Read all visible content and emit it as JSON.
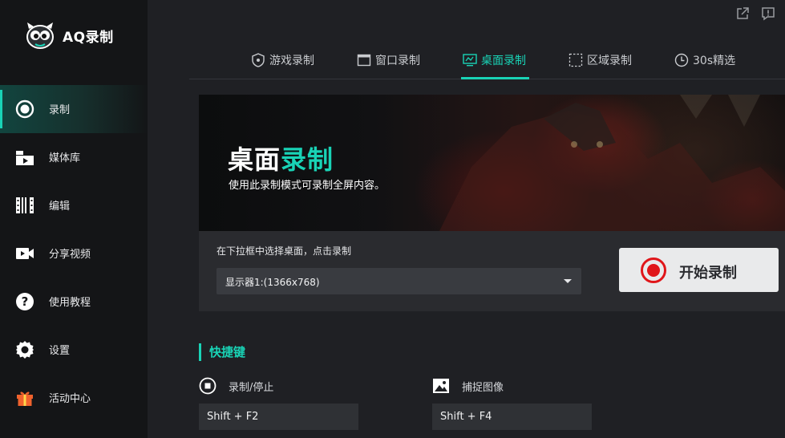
{
  "app": {
    "logo_text": "AQ录制"
  },
  "colors": {
    "accent": "#19d3b6",
    "sidebar_bg": "#141517",
    "main_bg": "#1f2024",
    "record_red": "#e0161a"
  },
  "sidebar": {
    "items": [
      {
        "label": "录制",
        "icon": "record-icon",
        "active": true
      },
      {
        "label": "媒体库",
        "icon": "media-library-icon"
      },
      {
        "label": "编辑",
        "icon": "film-edit-icon"
      },
      {
        "label": "分享视频",
        "icon": "video-camera-icon"
      },
      {
        "label": "使用教程",
        "icon": "help-icon"
      },
      {
        "label": "设置",
        "icon": "gear-icon"
      },
      {
        "label": "活动中心",
        "icon": "gift-icon"
      }
    ]
  },
  "window_controls": {
    "open_external_icon": "external-link-icon",
    "feedback_icon": "feedback-icon"
  },
  "tabs": [
    {
      "label": "游戏录制",
      "icon": "gamepad-shield-icon"
    },
    {
      "label": "窗口录制",
      "icon": "window-icon"
    },
    {
      "label": "桌面录制",
      "icon": "monitor-icon",
      "active": true
    },
    {
      "label": "区域录制",
      "icon": "region-select-icon"
    },
    {
      "label": "30s精选",
      "icon": "clock-icon"
    }
  ],
  "banner": {
    "title_main": "桌面",
    "title_accent": "录制",
    "subtitle": "使用此录制模式可录制全屏内容。"
  },
  "desktop_panel": {
    "hint": "在下拉框中选择桌面，点击录制",
    "selected_display": "显示器1:(1366x768)",
    "start_button": "开始录制"
  },
  "hotkeys": {
    "section_title": "快捷键",
    "items": [
      {
        "label": "录制/停止",
        "icon": "stop-circle-icon",
        "value": "Shift + F2"
      },
      {
        "label": "捕捉图像",
        "icon": "image-capture-icon",
        "value": "Shift + F4"
      }
    ]
  }
}
